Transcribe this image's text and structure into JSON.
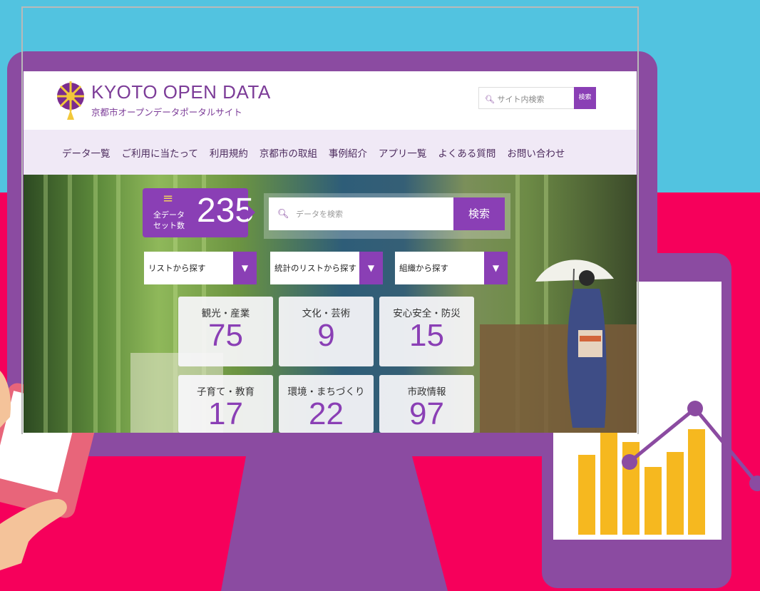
{
  "header": {
    "logo_title": "KYOTO OPEN DATA",
    "logo_subtitle": "京都市オープンデータポータルサイト",
    "search_placeholder": "サイト内検索",
    "search_button": "検索"
  },
  "nav": {
    "items": [
      {
        "label": "データ一覧"
      },
      {
        "label": "ご利用に当たって"
      },
      {
        "label": "利用規約"
      },
      {
        "label": "京都市の取組"
      },
      {
        "label": "事例紹介"
      },
      {
        "label": "アプリ一覧"
      },
      {
        "label": "よくある質問"
      },
      {
        "label": "お問い合わせ"
      }
    ]
  },
  "hero": {
    "total_label": "全データ\nセット数",
    "total_count": "235",
    "data_search_placeholder": "データを検索",
    "data_search_button": "検索",
    "selects": [
      {
        "label": "リストから探す"
      },
      {
        "label": "統計のリストから探す"
      },
      {
        "label": "組織から探す"
      }
    ],
    "categories": [
      {
        "label": "観光・産業",
        "count": "75"
      },
      {
        "label": "文化・芸術",
        "count": "9"
      },
      {
        "label": "安心安全・防災",
        "count": "15"
      },
      {
        "label": "子育て・教育",
        "count": "17"
      },
      {
        "label": "環境・まちづくり",
        "count": "22"
      },
      {
        "label": "市政情報",
        "count": "97"
      }
    ]
  },
  "colors": {
    "accent": "#8a3fb5",
    "device_frame": "#8b4ba1",
    "sky": "#52c3e0",
    "background_red": "#f6005b",
    "chart_bar": "#f6b81f"
  },
  "icons": {
    "site_search": "search-icon",
    "data_search": "search-icon",
    "total": "list-icon",
    "select_arrow": "triangle-down-icon"
  }
}
